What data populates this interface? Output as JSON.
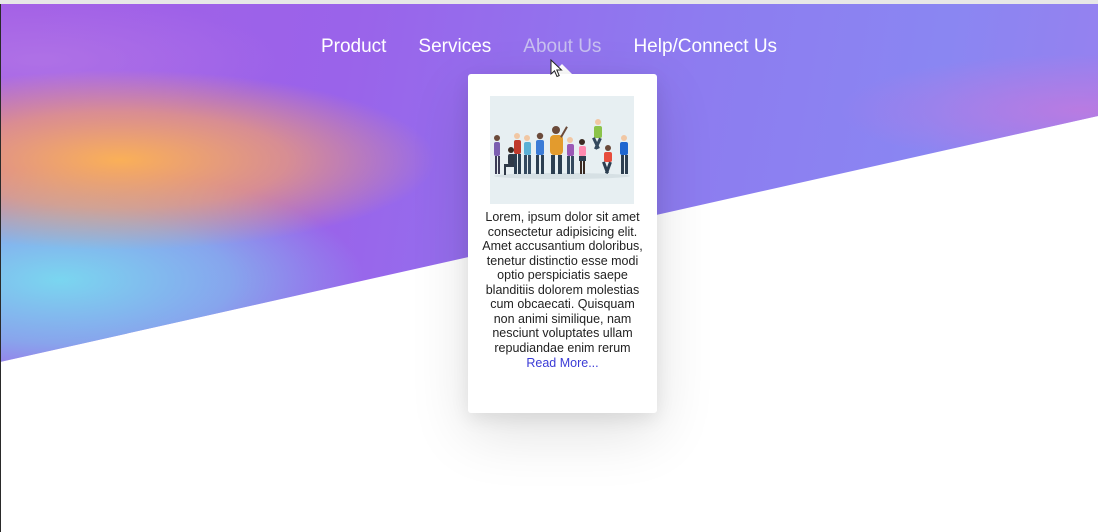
{
  "nav": {
    "items": [
      {
        "label": "Product",
        "active": false
      },
      {
        "label": "Services",
        "active": false
      },
      {
        "label": "About Us",
        "active": true
      },
      {
        "label": "Help/Connect Us",
        "active": false
      }
    ]
  },
  "dropdown": {
    "image_alt": "group of people illustration",
    "text": "Lorem, ipsum dolor sit amet consectetur adipisicing elit. Amet accusantium doloribus, tenetur distinctio esse modi optio perspiciatis saepe blanditiis dolorem molestias cum obcaecati. Quisquam non animi similique, nam nesciunt voluptates ullam repudiandae enim rerum",
    "read_more": "Read More..."
  },
  "colors": {
    "hero_primary": "#9a63ea",
    "hero_accent_orange": "#ffb450",
    "hero_accent_cyan": "#78dcf0",
    "nav_text": "#ffffff",
    "nav_active": "#c8c0f0",
    "link": "#3b3bd6"
  },
  "icons": {
    "cursor": "mouse-pointer-icon"
  }
}
